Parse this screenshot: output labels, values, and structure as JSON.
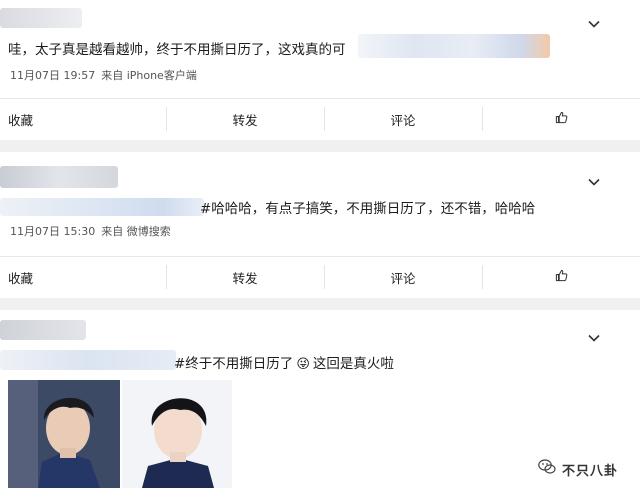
{
  "posts": [
    {
      "text": "哇，太子真是越看越帅，终于不用撕日历了，这戏真的可",
      "date": "11月07日 19:57",
      "source": "来自 iPhone客户端"
    },
    {
      "text": "#哈哈哈，有点子搞笑，不用撕日历了，还不错，哈哈哈",
      "date": "11月07日 15:30",
      "source": "来自 微博搜索"
    },
    {
      "text": "#终于不用撕日历了",
      "emoji": "😜",
      "text_after": "这回是真火啦"
    }
  ],
  "actions": {
    "favorite": "收藏",
    "repost": "转发",
    "comment": "评论"
  },
  "watermark": {
    "text": "不只八卦"
  },
  "icons": {
    "chevron": "chevron-down-icon",
    "like": "thumbs-up-icon",
    "watermark_logo": "wechat-logo-icon"
  },
  "colors": {
    "background": "#f0f0f2",
    "card": "#ffffff",
    "text": "#1c1c1c",
    "meta": "#555555",
    "divider": "#e8e8ea"
  }
}
